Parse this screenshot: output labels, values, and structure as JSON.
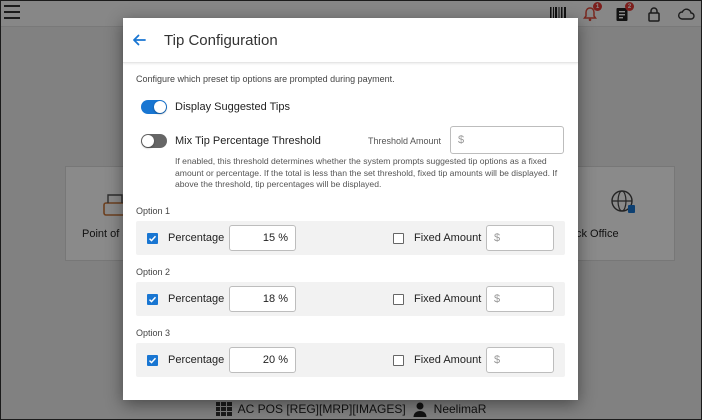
{
  "background": {
    "tiles": [
      {
        "label": "Point of S"
      },
      {
        "label": "ck Office"
      }
    ],
    "footer": {
      "pos_name": "AC POS [REG][MRP][IMAGES]",
      "user": "NeelimaR"
    },
    "badges": {
      "notifications": "1",
      "orders": "2"
    }
  },
  "dialog": {
    "title": "Tip Configuration",
    "description": "Configure which preset tip options are prompted during payment.",
    "display_suggested_tips": {
      "label": "Display Suggested Tips",
      "enabled": true
    },
    "mix_threshold": {
      "label": "Mix Tip Percentage Threshold",
      "enabled": false
    },
    "threshold_amount": {
      "label": "Threshold Amount",
      "placeholder": "$",
      "value": ""
    },
    "threshold_info": "If enabled, this threshold determines whether the system prompts suggested tip options as a fixed amount or percentage. If the total is less than the set threshold, fixed tip amounts will be displayed. If above the threshold, tip percentages will be displayed.",
    "options": [
      {
        "label": "Option 1",
        "percentage_label": "Percentage",
        "percentage_checked": true,
        "percentage_value": "15 %",
        "fixed_label": "Fixed Amount",
        "fixed_checked": false,
        "fixed_placeholder": "$"
      },
      {
        "label": "Option 2",
        "percentage_label": "Percentage",
        "percentage_checked": true,
        "percentage_value": "18 %",
        "fixed_label": "Fixed Amount",
        "fixed_checked": false,
        "fixed_placeholder": "$"
      },
      {
        "label": "Option 3",
        "percentage_label": "Percentage",
        "percentage_checked": true,
        "percentage_value": "20 %",
        "fixed_label": "Fixed Amount",
        "fixed_checked": false,
        "fixed_placeholder": "$"
      }
    ]
  },
  "colors": {
    "accent": "#1976d2",
    "toggle_off": "#666666",
    "overlay": "rgba(0,0,0,0.46)"
  },
  "icons": [
    "menu-icon",
    "barcode-icon",
    "bell-icon",
    "clipboard-icon",
    "lock-icon",
    "cloud-icon",
    "back-arrow-icon",
    "check-icon"
  ]
}
